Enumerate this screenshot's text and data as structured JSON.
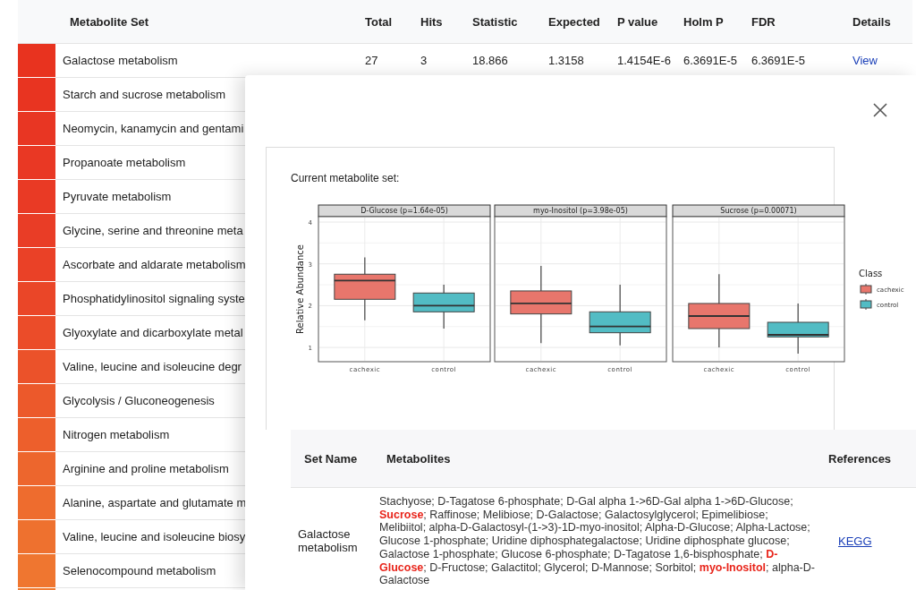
{
  "table": {
    "columns": [
      "Metabolite Set",
      "Total",
      "Hits",
      "Statistic",
      "Expected",
      "P value",
      "Holm P",
      "FDR",
      "Details"
    ],
    "rows": [
      {
        "name": "Galactose metabolism",
        "color": "#e8331f",
        "total": "27",
        "hits": "3",
        "statistic": "18.866",
        "expected": "1.3158",
        "p_value": "1.4154E-6",
        "holm_p": "6.3691E-5",
        "fdr": "6.3691E-5",
        "details": "View"
      },
      {
        "name": "Starch and sucrose metabolism",
        "color": "#e83421"
      },
      {
        "name": "Neomycin, kanamycin and gentami",
        "color": "#e83623"
      },
      {
        "name": "Propanoate metabolism",
        "color": "#e93824"
      },
      {
        "name": "Pyruvate metabolism",
        "color": "#e93a25"
      },
      {
        "name": "Glycine, serine and threonine meta",
        "color": "#e93d26"
      },
      {
        "name": "Ascorbate and aldarate metabolism",
        "color": "#ea4127"
      },
      {
        "name": "Phosphatidylinositol signaling syste",
        "color": "#ea4628"
      },
      {
        "name": "Glyoxylate and dicarboxylate metal",
        "color": "#eb4c29"
      },
      {
        "name": "Valine, leucine and isoleucine degr",
        "color": "#eb522a"
      },
      {
        "name": "Glycolysis / Gluconeogenesis",
        "color": "#ec592b"
      },
      {
        "name": "Nitrogen metabolism",
        "color": "#ed5f2c"
      },
      {
        "name": "Arginine and proline metabolism",
        "color": "#ed662d"
      },
      {
        "name": "Alanine, aspartate and glutamate m",
        "color": "#ee6c2e"
      },
      {
        "name": "Valine, leucine and isoleucine biosy",
        "color": "#ee712f"
      },
      {
        "name": "Selenocompound metabolism",
        "color": "#ef7630"
      },
      {
        "color": "#f07b31"
      }
    ]
  },
  "modal": {
    "title": "Current metabolite set:",
    "plot": {
      "y_label": "Relative Abundance",
      "y_ticks": [
        "4",
        "3",
        "2",
        "1"
      ],
      "panels": [
        {
          "title": "D-Glucose (p=1.64e-05)",
          "x_labels": [
            "cachexic",
            "control"
          ]
        },
        {
          "title": "myo-Inositol (p=3.98e-05)",
          "x_labels": [
            "cachexic",
            "control"
          ]
        },
        {
          "title": "Sucrose (p=0.00071)",
          "x_labels": [
            "cachexic",
            "control"
          ]
        }
      ],
      "legend": {
        "title": "Class",
        "items": [
          {
            "label": "cachexic",
            "color": "#e8766c"
          },
          {
            "label": "control",
            "color": "#52bcc4"
          }
        ]
      }
    },
    "set_table": {
      "columns": [
        "Set Name",
        "Metabolites",
        "References"
      ],
      "rows": [
        {
          "set_name": "Galactose metabolism",
          "metabolites": "Stachyose; D-Tagatose 6-phosphate; D-Gal alpha 1->6D-Gal alpha 1->6D-Glucose; **Sucrose**; Raffinose; Melibiose; D-Galactose; Galactosylglycerol; Epimelibiose; Melibiitol; alpha-D-Galactosyl-(1->3)-1D-myo-inositol; Alpha-D-Glucose; Alpha-Lactose; Glucose 1-phosphate; Uridine diphosphategalactose; Uridine diphosphate glucose; Galactose 1-phosphate; Glucose 6-phosphate; D-Tagatose 1,6-bisphosphate; **D-Glucose**; D-Fructose; Galactitol; Glycerol; D-Mannose; Sorbitol; **myo-Inositol**; alpha-D-Galactose",
          "reference": "KEGG"
        }
      ]
    }
  }
}
